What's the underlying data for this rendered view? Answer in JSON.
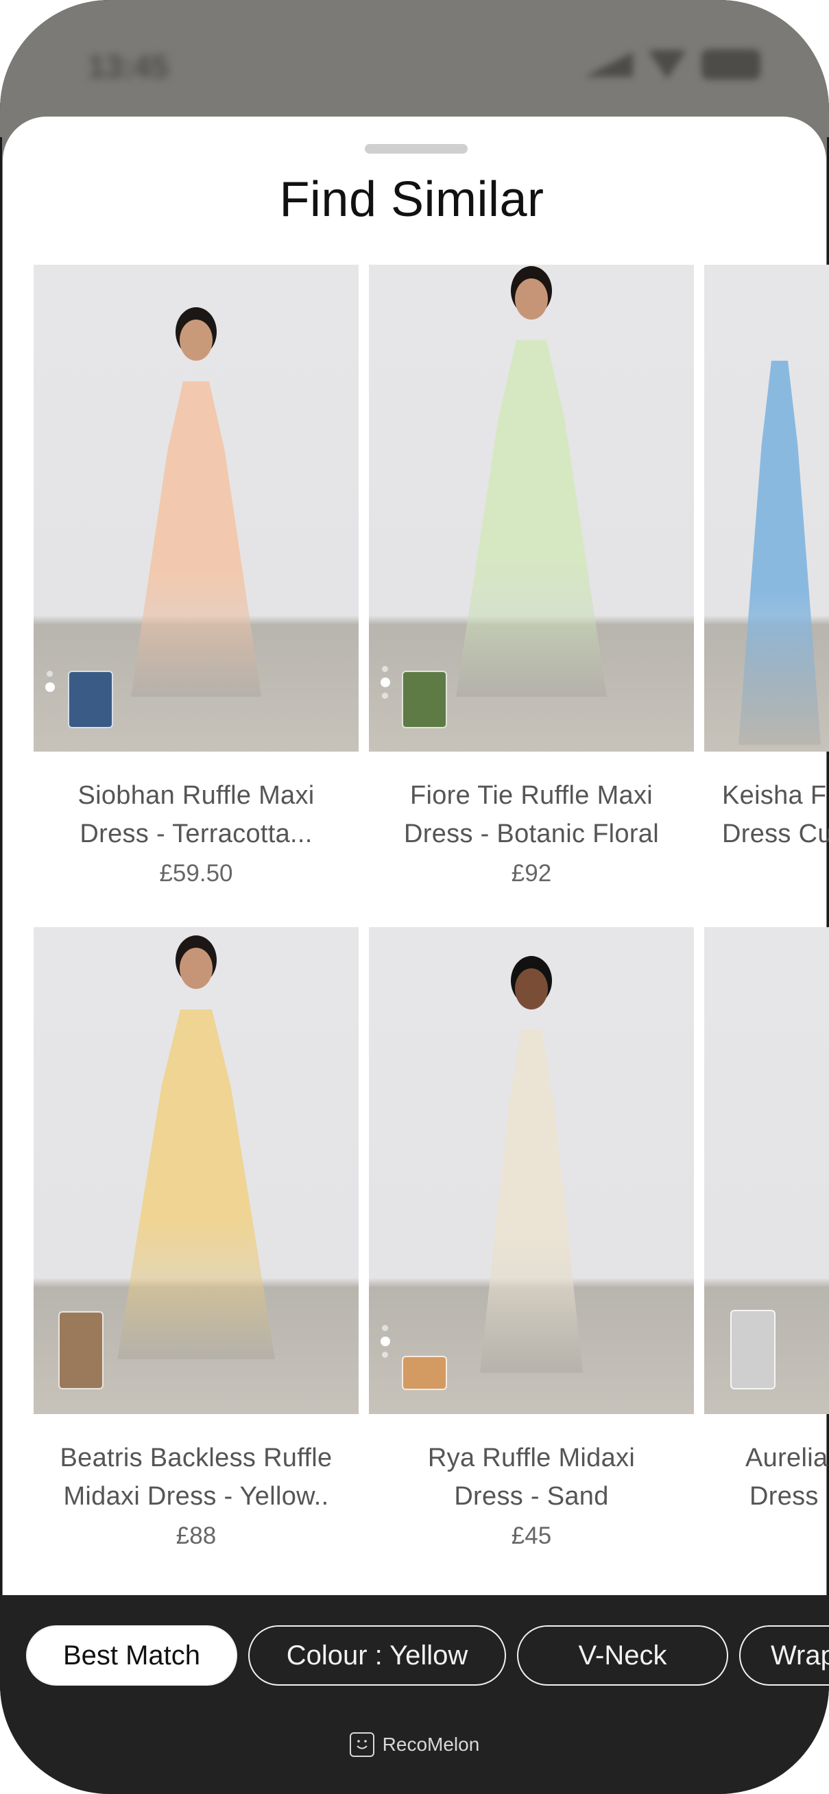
{
  "status_bar": {
    "time": "13:45"
  },
  "sheet": {
    "title": "Find Similar"
  },
  "products": [
    {
      "name_line1": "Siobhan Ruffle Maxi",
      "name_line2": "Dress - Terracotta...",
      "price": "£59.50",
      "dress_color": "#f2c9ae",
      "skin_color": "#c99a7a",
      "hair_color": "#1c1715",
      "thumb_color": "#3a5b85"
    },
    {
      "name_line1": "Fiore Tie Ruffle Maxi",
      "name_line2": "Dress - Botanic Floral",
      "price": "£92",
      "dress_color": "#d6e8c2",
      "skin_color": "#c69577",
      "hair_color": "#1a1412",
      "thumb_color": "#5e7a45"
    },
    {
      "name_line1": "Keisha F",
      "name_line2": "Dress Cu",
      "price": "",
      "dress_color": "#8ab9e0",
      "skin_color": "#c08a6a",
      "hair_color": "#1a1412",
      "thumb_color": ""
    },
    {
      "name_line1": "Beatris Backless Ruffle",
      "name_line2": "Midaxi Dress - Yellow..",
      "price": "£88",
      "dress_color": "#efd493",
      "skin_color": "#c69577",
      "hair_color": "#1c1715",
      "thumb_color": "#9a7a5a"
    },
    {
      "name_line1": "Rya Ruffle Midaxi",
      "name_line2": "Dress - Sand",
      "price": "£45",
      "dress_color": "#ebe3d3",
      "skin_color": "#7a4e36",
      "hair_color": "#111111",
      "thumb_color": "#d39a62"
    },
    {
      "name_line1": "Aurelia",
      "name_line2": "Dress",
      "price": "",
      "dress_color": "#e9e2b0",
      "skin_color": "#c08a6a",
      "hair_color": "#1a1412",
      "thumb_color": "#cfcfcf"
    }
  ],
  "filters": [
    {
      "label": "Best Match",
      "active": true
    },
    {
      "label": "Colour : Yellow",
      "active": false
    },
    {
      "label": "V-Neck",
      "active": false
    },
    {
      "label": "Wrap",
      "active": false
    }
  ],
  "brand": {
    "name": "RecoMelon"
  },
  "colors": {
    "bottom_bar": "#222222",
    "status_bar": "#7b7a76"
  }
}
